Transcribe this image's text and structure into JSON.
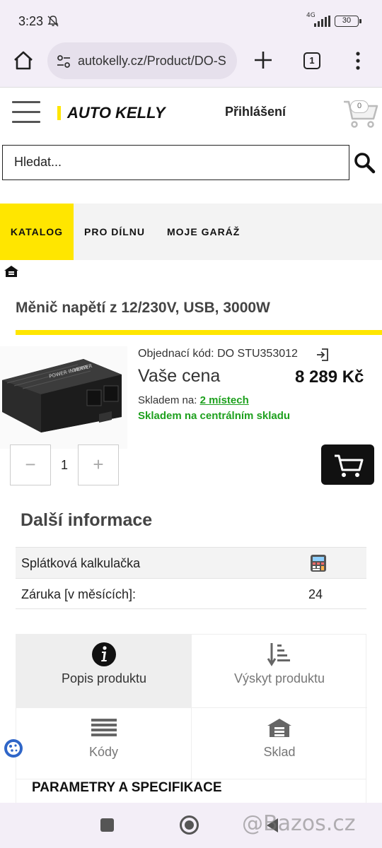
{
  "status_bar": {
    "time": "3:23",
    "network": "4G",
    "battery": "30"
  },
  "browser": {
    "url": "autokelly.cz/Product/DO-S",
    "tab_count": "1"
  },
  "header": {
    "logo": "AUTO KELLY",
    "login": "Přihlášení",
    "cart_count": "0"
  },
  "search": {
    "placeholder": "Hledat..."
  },
  "nav": {
    "items": [
      "KATALOG",
      "PRO DÍLNU",
      "MOJE GARÁŽ"
    ]
  },
  "product": {
    "title": "Měnič napětí z 12/230V, USB, 3000W",
    "order_code": "Objednací kód: DO STU353012",
    "price_label": "Vaše cena",
    "price": "8 289 Kč",
    "stock_label": "Skladem na:",
    "stock_link": "2 místech",
    "stock_central": "Skladem na centrálním skladu",
    "quantity": "1",
    "qty_minus": "−",
    "qty_plus": "+"
  },
  "info": {
    "heading": "Další informace",
    "rows": [
      {
        "key": "Splátková kalkulačka",
        "value": ""
      },
      {
        "key": "Záruka [v měsících]:",
        "value": "24"
      }
    ]
  },
  "tabs": {
    "items": [
      {
        "label": "Popis produktu",
        "icon": "info-icon"
      },
      {
        "label": "Výskyt produktu",
        "icon": "sort-icon"
      },
      {
        "label": "Kódy",
        "icon": "list-icon"
      },
      {
        "label": "Sklad",
        "icon": "warehouse-icon"
      }
    ]
  },
  "params_heading": "PARAMETRY A SPECIFIKACE",
  "watermark": "@Bazos.cz",
  "colors": {
    "brand_yellow": "#ffe600",
    "stock_green": "#1ea01e"
  }
}
